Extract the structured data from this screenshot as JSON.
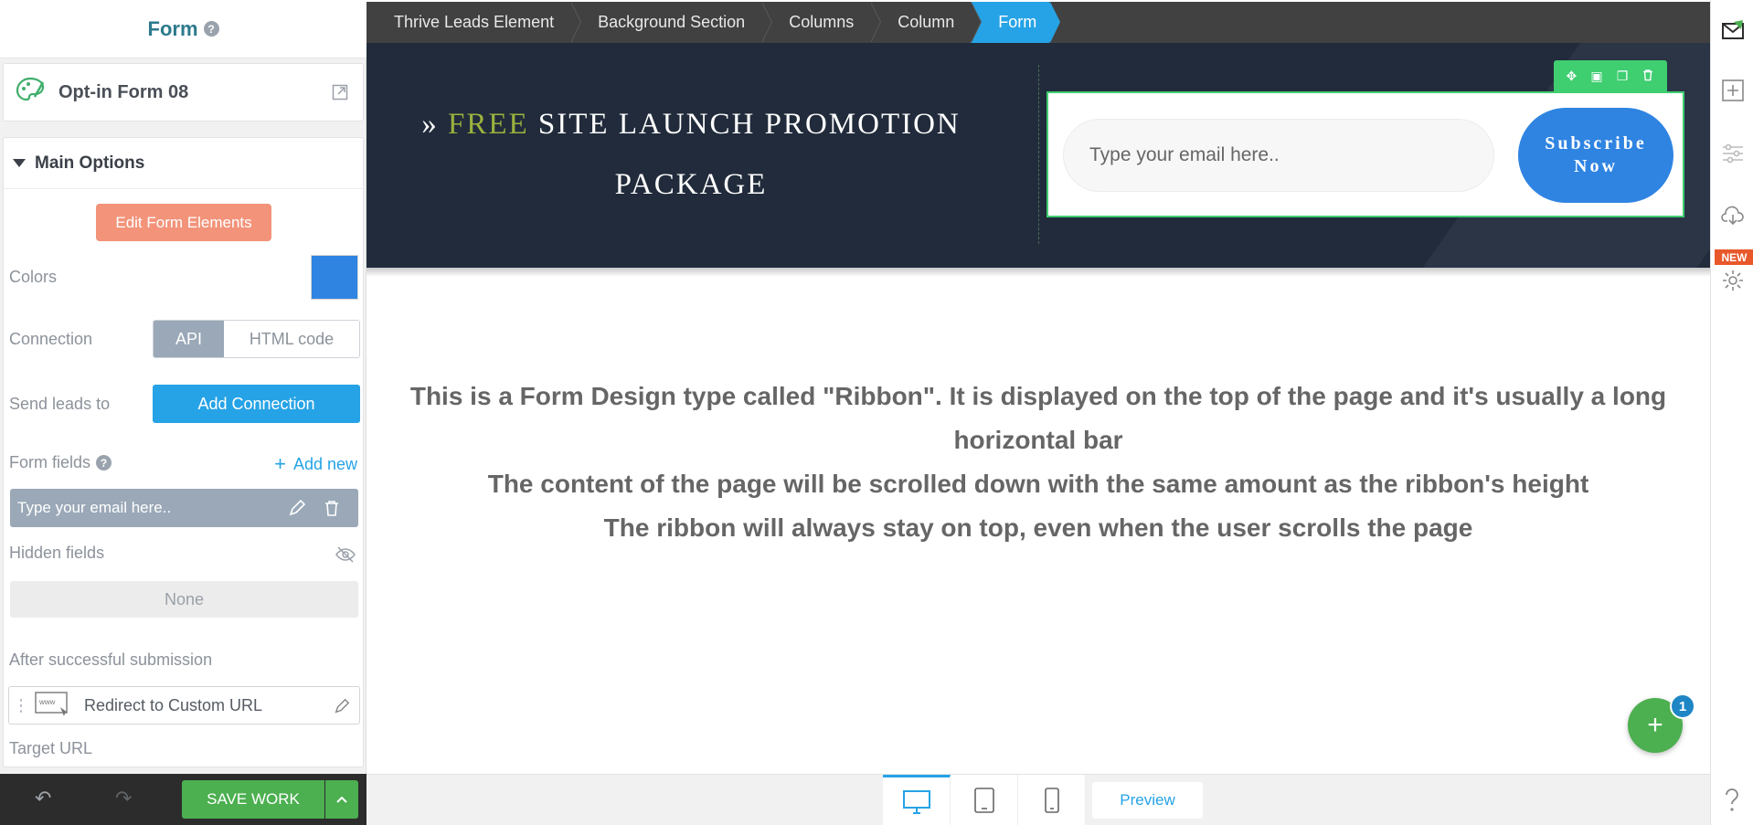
{
  "sidebar": {
    "title": "Form",
    "help_glyph": "?",
    "element_name": "Opt-in Form 08",
    "main_options_label": "Main Options",
    "edit_form_elements_label": "Edit Form Elements",
    "colors_label": "Colors",
    "color_value": "#2f84e2",
    "connection_label": "Connection",
    "connection_options": [
      "API",
      "HTML code"
    ],
    "connection_selected": "API",
    "send_leads_label": "Send leads to",
    "add_connection_label": "Add Connection",
    "form_fields_label": "Form fields",
    "add_new_label": "Add new",
    "form_field_item": "Type your email here..",
    "hidden_fields_label": "Hidden fields",
    "hidden_fields_value": "None",
    "after_submission_label": "After successful submission",
    "redirect_label": "Redirect to Custom URL",
    "target_url_label": "Target URL",
    "save_label": "SAVE WORK"
  },
  "breadcrumbs": [
    "Thrive Leads Element",
    "Background Section",
    "Columns",
    "Column",
    "Form"
  ],
  "ribbon": {
    "promo_prefix": "» ",
    "promo_highlight": "FREE",
    "promo_rest": " SITE LAUNCH PROMOTION PACKAGE",
    "email_placeholder": "Type your email here..",
    "subscribe_label": "Subscribe Now"
  },
  "description": [
    "This is a Form Design type called \"Ribbon\". It is displayed on the top of the page and it's usually a long horizontal bar",
    "The content of the page will be scrolled down with the same amount as the ribbon's height",
    "The ribbon will always stay on top, even when the user scrolls the page"
  ],
  "fab": {
    "label": "+",
    "badge": "1"
  },
  "device_bar": {
    "preview_label": "Preview",
    "devices": [
      "desktop-icon",
      "tablet-icon",
      "mobile-icon"
    ],
    "active": "desktop-icon"
  },
  "right_rail": {
    "new_badge": "NEW"
  },
  "colors": {
    "accent": "#26a3e6",
    "save_green": "#4caf50",
    "ribbon_bg": "#212b3b",
    "highlight": "#9bb13e",
    "edit_button": "#f2937a"
  }
}
